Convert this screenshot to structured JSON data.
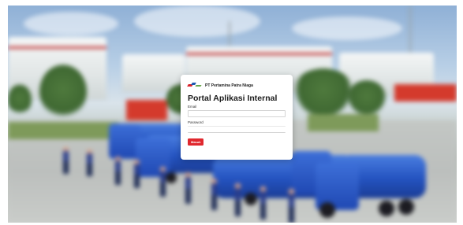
{
  "login": {
    "company_name": "PT Pertamina Patra Niaga",
    "title": "Portal Aplikasi Internal",
    "email_label": "Email",
    "email_value": "",
    "password_label": "Password",
    "password_value": "",
    "submit_label": "Masuk"
  },
  "background": {
    "logo_icon": "pertamina-logo-icon",
    "accent_color": "#e0282e"
  }
}
